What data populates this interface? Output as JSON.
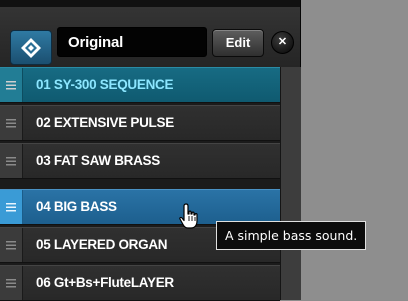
{
  "header": {
    "logo_icon": "diamond-logo-icon",
    "patch_name": "Original",
    "edit_label": "Edit",
    "close_symbol": "✕"
  },
  "patch_list": {
    "items": [
      {
        "label": "01  SY-300 SEQUENCE",
        "state": "active"
      },
      {
        "label": "02  EXTENSIVE PULSE",
        "state": "normal"
      },
      {
        "label": "03  FAT SAW BRASS",
        "state": "normal"
      },
      {
        "label": "04  BIG BASS",
        "state": "selected"
      },
      {
        "label": "05  LAYERED ORGAN",
        "state": "normal"
      },
      {
        "label": "06  Gt+Bs+FluteLAYER",
        "state": "normal"
      }
    ]
  },
  "tooltip": {
    "text": "A simple bass sound."
  },
  "colors": {
    "active_row": "#176b83",
    "active_text": "#8ce6ff",
    "selected_row": "#2a73a6",
    "selected_handle": "#3a9bd6"
  }
}
